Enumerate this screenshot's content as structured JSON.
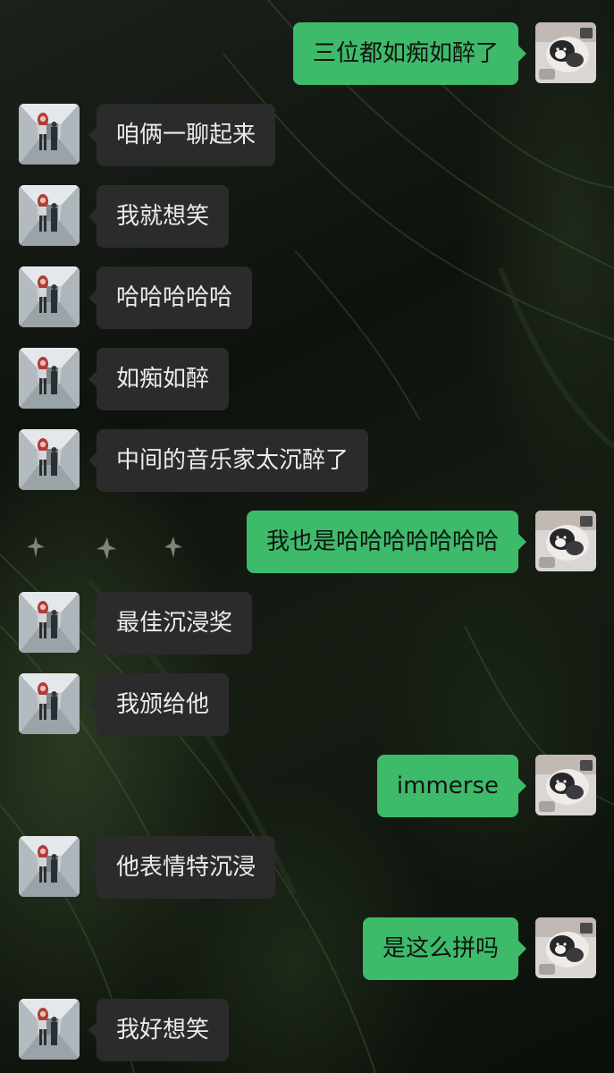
{
  "colors": {
    "outgoing_bubble": "#3dbb6a",
    "incoming_bubble": "#2b2b2b",
    "incoming_text": "#ebebeb",
    "outgoing_text": "#121212"
  },
  "messages": [
    {
      "side": "out",
      "text": "三位都如痴如醉了"
    },
    {
      "side": "in",
      "text": "咱俩一聊起来"
    },
    {
      "side": "in",
      "text": "我就想笑"
    },
    {
      "side": "in",
      "text": "哈哈哈哈哈"
    },
    {
      "side": "in",
      "text": "如痴如醉"
    },
    {
      "side": "in",
      "text": "中间的音乐家太沉醉了"
    },
    {
      "side": "out",
      "text": "我也是哈哈哈哈哈哈哈"
    },
    {
      "side": "in",
      "text": "最佳沉浸奖"
    },
    {
      "side": "in",
      "text": "我颁给他"
    },
    {
      "side": "out",
      "text": "immerse"
    },
    {
      "side": "in",
      "text": "他表情特沉浸"
    },
    {
      "side": "out",
      "text": "是这么拼吗"
    },
    {
      "side": "in",
      "text": "我好想笑"
    }
  ],
  "avatars": {
    "self": "sleeping-cat-avatar",
    "contact": "girl-in-corridor-avatar"
  }
}
